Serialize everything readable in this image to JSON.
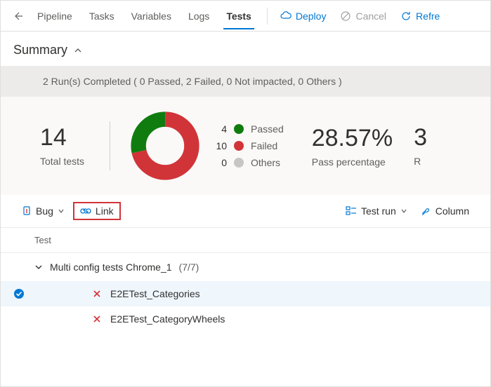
{
  "nav": {
    "pipeline": "Pipeline",
    "tasks": "Tasks",
    "variables": "Variables",
    "logs": "Logs",
    "tests": "Tests"
  },
  "actions": {
    "deploy": "Deploy",
    "cancel": "Cancel",
    "refresh": "Refre"
  },
  "summary": {
    "title": "Summary",
    "runs_banner": "2 Run(s) Completed ( 0 Passed, 2 Failed, 0 Not impacted, 0 Others )"
  },
  "stats": {
    "total_value": "14",
    "total_label": "Total tests",
    "legend": {
      "passed_count": "4",
      "passed_label": "Passed",
      "failed_count": "10",
      "failed_label": "Failed",
      "others_count": "0",
      "others_label": "Others"
    },
    "pct_value": "28.57%",
    "pct_label": "Pass percentage",
    "extra_hint": "3",
    "extra_label": "R"
  },
  "chart_data": {
    "type": "pie",
    "title": "Test results",
    "series": [
      {
        "name": "Passed",
        "value": 4,
        "color": "#107c10"
      },
      {
        "name": "Failed",
        "value": 10,
        "color": "#d13438"
      },
      {
        "name": "Others",
        "value": 0,
        "color": "#c8c6c4"
      }
    ]
  },
  "toolbar": {
    "bug": "Bug",
    "link": "Link",
    "test_run": "Test run",
    "columns": "Column"
  },
  "table": {
    "header": "Test",
    "group": {
      "name": "Multi config tests Chrome_1",
      "count": "(7/7)"
    },
    "rows": {
      "r1": "E2ETest_Categories",
      "r2": "E2ETest_CategoryWheels"
    }
  }
}
